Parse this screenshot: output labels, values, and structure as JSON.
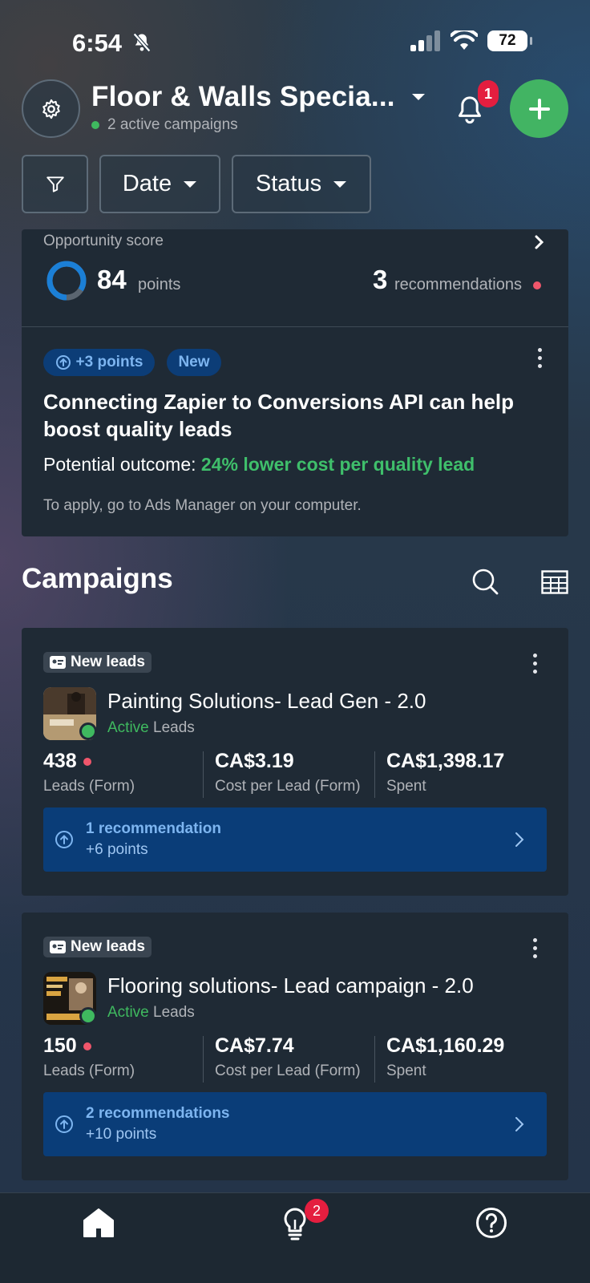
{
  "status_bar": {
    "time": "6:54",
    "battery": "72"
  },
  "header": {
    "account_name": "Floor & Walls Specia...",
    "active_campaigns": "2 active campaigns",
    "notification_count": "1"
  },
  "filters": {
    "date_label": "Date",
    "status_label": "Status"
  },
  "opportunity": {
    "label": "Opportunity score",
    "score": "84",
    "score_unit": "points",
    "score_fraction": 0.84,
    "recommendations_count": "3",
    "recommendations_label": "recommendations",
    "pill_points": "+3 points",
    "pill_new": "New",
    "title": "Connecting Zapier to Conversions API can help boost quality leads",
    "outcome_prefix": "Potential outcome: ",
    "outcome_highlight": "24% lower cost per quality lead",
    "apply_note": "To apply, go to Ads Manager on your computer."
  },
  "campaigns": {
    "title": "Campaigns",
    "items": [
      {
        "tag": "New leads",
        "name": "Painting Solutions- Lead Gen - 2.0",
        "status": "Active",
        "objective": "Leads",
        "metric1_value": "438",
        "metric1_label": "Leads (Form)",
        "metric2_value": "CA$3.19",
        "metric2_label": "Cost per Lead (Form)",
        "metric3_value": "CA$1,398.17",
        "metric3_label": "Spent",
        "rec_title": "1 recommendation",
        "rec_points": "+6 points"
      },
      {
        "tag": "New leads",
        "name": "Flooring solutions- Lead campaign - 2.0",
        "status": "Active",
        "objective": "Leads",
        "metric1_value": "150",
        "metric1_label": "Leads (Form)",
        "metric2_value": "CA$7.74",
        "metric2_label": "Cost per Lead (Form)",
        "metric3_value": "CA$1,160.29",
        "metric3_label": "Spent",
        "rec_title": "2 recommendations",
        "rec_points": "+10 points"
      }
    ]
  },
  "bottom_nav": {
    "items": [
      {
        "icon": "home-icon"
      },
      {
        "icon": "lightbulb-icon",
        "badge": "2"
      },
      {
        "icon": "help-icon"
      }
    ]
  },
  "colors": {
    "accent_green": "#42b463",
    "badge_red": "#e41e3f",
    "recommendation_blue": "#0a3d78"
  }
}
